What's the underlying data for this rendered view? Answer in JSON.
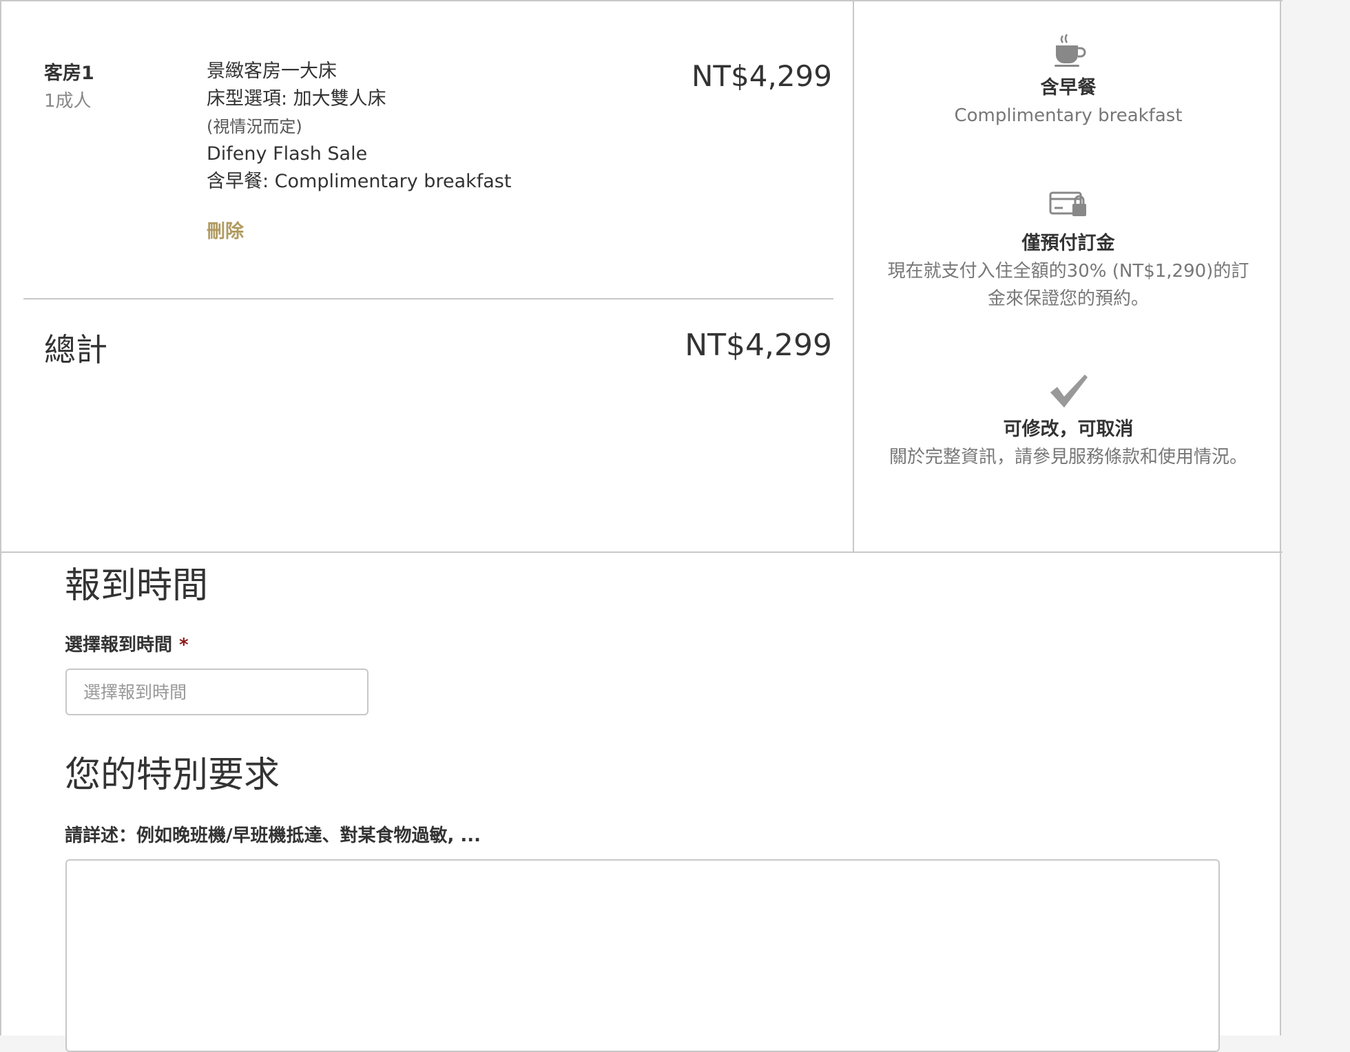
{
  "booking": {
    "room_label": "客房1",
    "occupancy": "1成人",
    "room_name": "景緻客房一大床",
    "bed_option": "床型選項: 加大雙人床",
    "bed_note": "(視情況而定)",
    "rate_name": "Difeny Flash Sale",
    "meal": "含早餐: Complimentary breakfast",
    "remove_label": "刪除",
    "room_price": "NT$4,299",
    "total_label": "總計",
    "total_price": "NT$4,299"
  },
  "features": [
    {
      "icon": "coffee-cup-icon",
      "title": "含早餐",
      "desc": "Complimentary breakfast"
    },
    {
      "icon": "card-lock-icon",
      "title": "僅預付訂金",
      "desc": "現在就支付入住全額的30% (NT$1,290)的訂金來保證您的預約。"
    },
    {
      "icon": "checkmark-icon",
      "title": "可修改，可取消",
      "desc": "關於完整資訊，請參見服務條款和使用情況。"
    }
  ],
  "checkin": {
    "title": "報到時間",
    "label": "選擇報到時間",
    "required_mark": "*",
    "placeholder": "選擇報到時間"
  },
  "special": {
    "title": "您的特別要求",
    "label": "請詳述：例如晚班機/早班機抵達、對某食物過敏, ...",
    "value": ""
  },
  "colors": {
    "accent": "#b09a5f",
    "required": "#8b1a1a",
    "border": "#c8c8c8"
  }
}
